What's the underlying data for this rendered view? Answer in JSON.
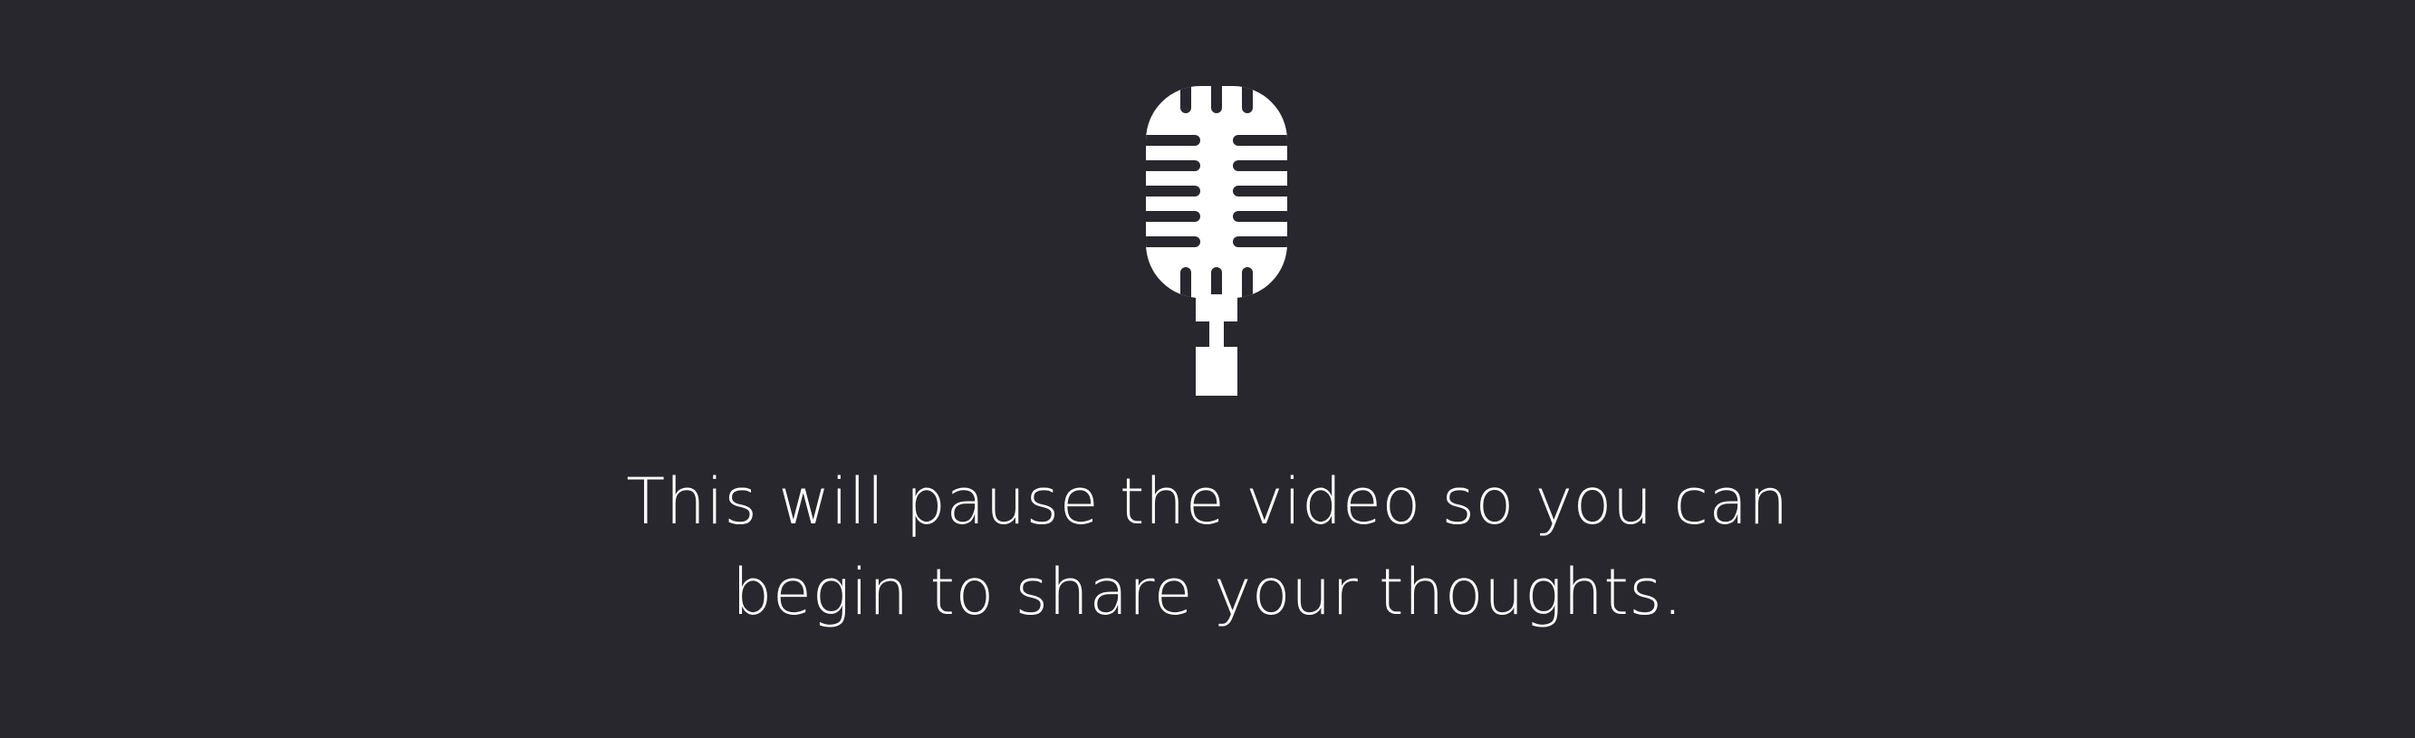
{
  "overlay": {
    "icon": "microphone-icon",
    "message_lines": [
      "This will pause the video so you can",
      "begin to share your thoughts."
    ]
  },
  "colors": {
    "background": "#28272d",
    "foreground": "#ffffff"
  }
}
